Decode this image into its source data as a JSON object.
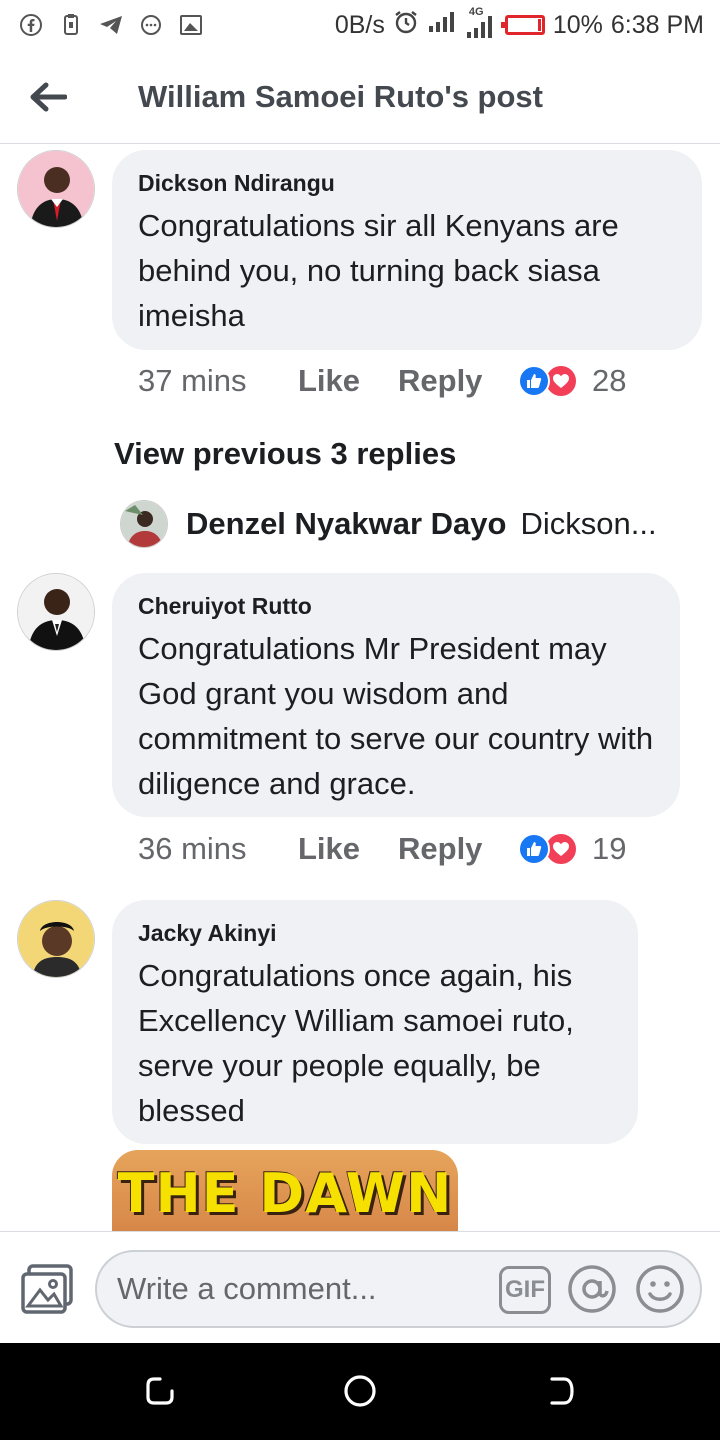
{
  "status_bar": {
    "net_speed": "0B/s",
    "network_label": "4G",
    "battery": "10%",
    "time": "6:38 PM",
    "battery_level": 0.1
  },
  "header": {
    "title": "William Samoei Ruto's post"
  },
  "comments": [
    {
      "author": "Dickson Ndirangu",
      "text": "Congratulations  sir all Kenyans  are behind  you, no turning  back  siasa imeisha",
      "time": "37 mins",
      "like": "Like",
      "reply": "Reply",
      "reactions": "28"
    },
    {
      "author": "Cheruiyot Rutto",
      "text": "Congratulations Mr President may God grant you wisdom and commitment to serve our country with diligence and grace.",
      "time": "36 mins",
      "like": "Like",
      "reply": "Reply",
      "reactions": "19"
    },
    {
      "author": "Jacky Akinyi",
      "text": "Congratulations once again, his Excellency William samoei ruto, serve your people equally, be blessed",
      "attachment_text": "THE DAWN"
    }
  ],
  "view_previous": "View previous 3 replies",
  "reply_preview": {
    "name": "Denzel Nyakwar Dayo",
    "snippet": "Dickson..."
  },
  "composer": {
    "placeholder": "Write a comment...",
    "gif_label": "GIF"
  },
  "colors": {
    "like_blue": "#1877f2",
    "love_red": "#f33e58",
    "bubble_bg": "#eff1f4",
    "battery_red": "#e0262b"
  }
}
